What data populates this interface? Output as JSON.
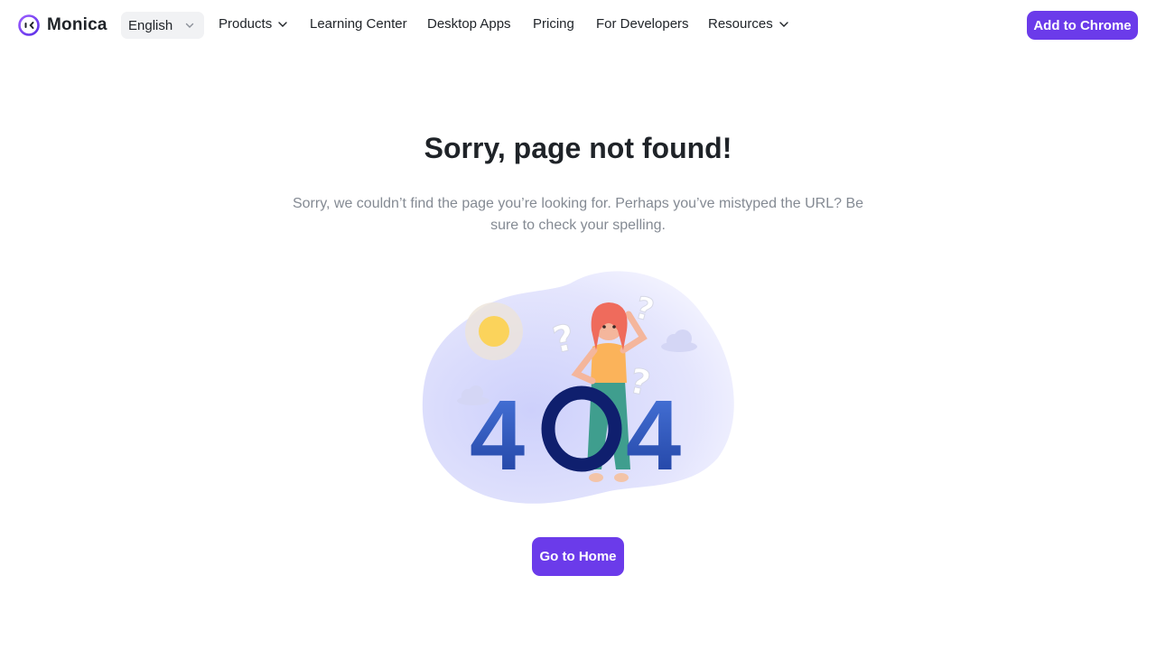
{
  "brand": {
    "name": "Monica",
    "accent": "#6b3bea"
  },
  "header": {
    "language": "English",
    "menu": [
      {
        "label": "Products",
        "dropdown": true
      },
      {
        "label": "Learning Center",
        "dropdown": false
      },
      {
        "label": "Desktop Apps",
        "dropdown": false
      },
      {
        "label": "Pricing",
        "dropdown": false
      },
      {
        "label": "For Developers",
        "dropdown": false
      },
      {
        "label": "Resources",
        "dropdown": true
      }
    ],
    "cta_label": "Add to Chrome"
  },
  "main": {
    "title": "Sorry, page not found!",
    "description": "Sorry, we couldn’t find the page you’re looking for. Perhaps you’ve mistyped the URL? Be sure to check your spelling.",
    "illustration": {
      "digits": [
        "4",
        "0",
        "4"
      ],
      "icons": [
        "sun-icon",
        "cloud-icon",
        "question-mark-icon",
        "girl-figure"
      ]
    },
    "home_button_label": "Go to Home"
  }
}
